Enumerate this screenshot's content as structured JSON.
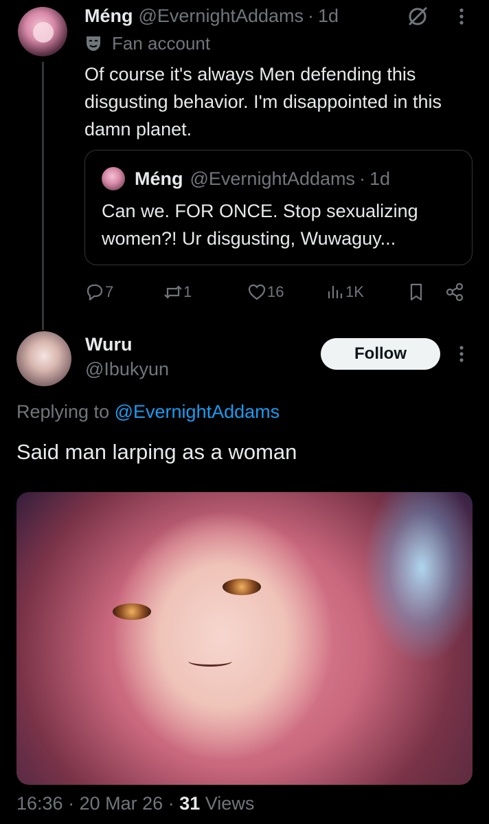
{
  "parent_tweet": {
    "display_name": "Méng",
    "handle": "@EvernightAddams",
    "separator": "·",
    "age": "1d",
    "label": "Fan account",
    "text": "Of course it's always Men defending this disgusting behavior. I'm disappointed in this damn planet.",
    "quote": {
      "display_name": "Méng",
      "handle": "@EvernightAddams",
      "separator": "·",
      "age": "1d",
      "text": "Can we. FOR ONCE. Stop sexualizing women?! Ur disgusting, Wuwaguy..."
    },
    "actions": {
      "replies": "7",
      "reposts": "1",
      "likes": "16",
      "views": "1K"
    }
  },
  "reply_tweet": {
    "display_name": "Wuru",
    "handle": "@Ibukyun",
    "follow_label": "Follow",
    "replying_prefix": "Replying to",
    "replying_to": "@EvernightAddams",
    "text": "Said man larping as a woman",
    "timestamp": {
      "time": "16:36",
      "sep1": "·",
      "date": "20 Mar 26",
      "sep2": "·",
      "views_count": "31",
      "views_label": "Views"
    }
  },
  "icons": {
    "grok": "grok-icon",
    "more": "more-vertical-icon",
    "mask": "mask-icon",
    "reply": "reply-icon",
    "repost": "repost-icon",
    "like": "heart-icon",
    "views": "bar-chart-icon",
    "bookmark": "bookmark-icon",
    "share": "share-icon"
  },
  "colors": {
    "background": "#000000",
    "text": "#e7e9ea",
    "muted": "#71767b",
    "link": "#1d9bf0",
    "border": "#333639",
    "button_bg": "#eff3f4"
  }
}
